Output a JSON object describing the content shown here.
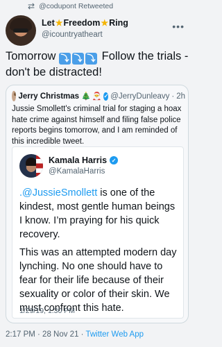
{
  "retweet": {
    "icon": "retweet-icon",
    "text": "@codupont Retweeted"
  },
  "author": {
    "name_part1": "Let",
    "name_part2": "Freedom",
    "name_part3": "Ring",
    "star": "★",
    "handle": "@icountryatheart",
    "more": "•••"
  },
  "tweet": {
    "text_before": "Tomorrow",
    "arrows": [
      "⤵",
      "⤵",
      "⤵"
    ],
    "text_after": " Follow the trials - don't be distracted!"
  },
  "quoted": {
    "name": "Jerry Christmas",
    "tree": "🎄",
    "santa": "🎅",
    "verified": "✓",
    "handle": "@JerryDunleavy",
    "dot": "·",
    "age": "2h",
    "text": "Jussie Smollett's  criminal trial for staging a hoax hate crime against himself and filing false police reports begins tomorrow, and I am reminded of this incredible tweet."
  },
  "embedded": {
    "name": "Kamala Harris",
    "verified": "✓",
    "handle": "@KamalaHarris",
    "mention": ".@JussieSmollett",
    "para1_rest": " is one of the kindest, most gentle human beings I know. I’m praying for his quick recovery.",
    "para2": "This was an attempted modern day lynching. No one should have to fear for their life because of their sexuality or color of their skin. We must confront this hate.",
    "timestamp": "1/29/19, 1:30 PM"
  },
  "footer": {
    "time": "2:17 PM · 28 Nov 21 · ",
    "source": "Twitter Web App"
  },
  "colors": {
    "link": "#1d9bf0",
    "muted": "#536471",
    "star": "#f4b400"
  }
}
